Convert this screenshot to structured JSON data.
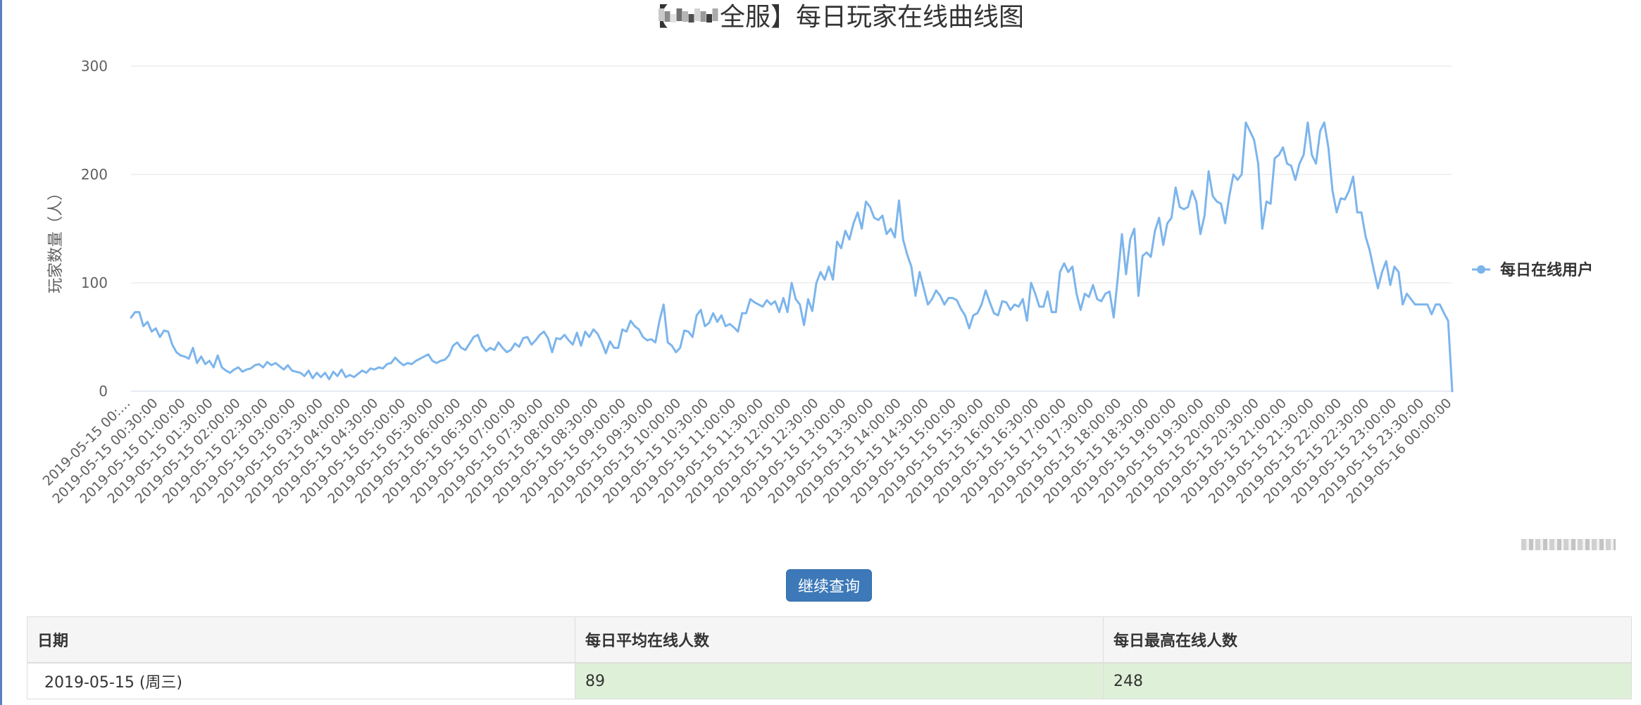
{
  "chart_data": {
    "type": "line",
    "title_prefix": "【",
    "title": "全服】每日玩家在线曲线图",
    "ylabel": "玩家数量（人）",
    "ylim": [
      0,
      300
    ],
    "yticks": [
      0,
      100,
      200,
      300
    ],
    "x_labels": [
      "2019-05-15 00:…",
      "2019-05-15 00:30:00",
      "2019-05-15 01:00:00",
      "2019-05-15 01:30:00",
      "2019-05-15 02:00:00",
      "2019-05-15 02:30:00",
      "2019-05-15 03:00:00",
      "2019-05-15 03:30:00",
      "2019-05-15 04:00:00",
      "2019-05-15 04:30:00",
      "2019-05-15 05:00:00",
      "2019-05-15 05:30:00",
      "2019-05-15 06:00:00",
      "2019-05-15 06:30:00",
      "2019-05-15 07:00:00",
      "2019-05-15 07:30:00",
      "2019-05-15 08:00:00",
      "2019-05-15 08:30:00",
      "2019-05-15 09:00:00",
      "2019-05-15 09:30:00",
      "2019-05-15 10:00:00",
      "2019-05-15 10:30:00",
      "2019-05-15 11:00:00",
      "2019-05-15 11:30:00",
      "2019-05-15 12:00:00",
      "2019-05-15 12:30:00",
      "2019-05-15 13:00:00",
      "2019-05-15 13:30:00",
      "2019-05-15 14:00:00",
      "2019-05-15 14:30:00",
      "2019-05-15 15:00:00",
      "2019-05-15 15:30:00",
      "2019-05-15 16:00:00",
      "2019-05-15 16:30:00",
      "2019-05-15 17:00:00",
      "2019-05-15 17:30:00",
      "2019-05-15 18:00:00",
      "2019-05-15 18:30:00",
      "2019-05-15 19:00:00",
      "2019-05-15 19:30:00",
      "2019-05-15 20:00:00",
      "2019-05-15 20:30:00",
      "2019-05-15 21:00:00",
      "2019-05-15 21:30:00",
      "2019-05-15 22:00:00",
      "2019-05-15 22:30:00",
      "2019-05-15 23:00:00",
      "2019-05-15 23:30:00",
      "2019-05-16 00:00:00"
    ],
    "series": [
      {
        "name": "每日在线用户",
        "color": "#7cb5ec",
        "values": [
          68,
          73,
          73,
          60,
          64,
          55,
          58,
          50,
          56,
          55,
          43,
          36,
          33,
          32,
          30,
          40,
          26,
          32,
          25,
          28,
          22,
          33,
          22,
          19,
          17,
          20,
          22,
          18,
          20,
          21,
          24,
          25,
          22,
          27,
          24,
          26,
          23,
          20,
          24,
          19,
          18,
          17,
          14,
          19,
          12,
          17,
          13,
          17,
          11,
          18,
          14,
          20,
          13,
          15,
          13,
          16,
          19,
          17,
          21,
          20,
          22,
          21,
          25,
          26,
          31,
          27,
          24,
          26,
          25,
          28,
          30,
          32,
          34,
          28,
          26,
          28,
          29,
          33,
          42,
          45,
          40,
          38,
          44,
          50,
          52,
          42,
          37,
          40,
          38,
          45,
          40,
          36,
          38,
          44,
          41,
          49,
          50,
          43,
          47,
          52,
          55,
          49,
          36,
          49,
          48,
          52,
          47,
          43,
          54,
          42,
          55,
          50,
          57,
          53,
          45,
          35,
          46,
          40,
          40,
          57,
          55,
          65,
          60,
          57,
          50,
          47,
          48,
          45,
          65,
          80,
          45,
          42,
          36,
          40,
          56,
          55,
          50,
          70,
          75,
          60,
          63,
          72,
          64,
          70,
          60,
          62,
          59,
          55,
          72,
          72,
          85,
          82,
          80,
          78,
          84,
          80,
          83,
          73,
          86,
          73,
          100,
          85,
          80,
          61,
          85,
          74,
          100,
          110,
          103,
          115,
          103,
          138,
          132,
          148,
          140,
          155,
          165,
          150,
          175,
          170,
          160,
          158,
          162,
          145,
          150,
          142,
          176,
          140,
          126,
          115,
          88,
          110,
          95,
          80,
          85,
          93,
          88,
          80,
          86,
          86,
          84,
          76,
          70,
          58,
          70,
          72,
          80,
          93,
          82,
          72,
          70,
          83,
          82,
          75,
          80,
          78,
          85,
          65,
          100,
          90,
          78,
          78,
          92,
          73,
          73,
          110,
          118,
          110,
          115,
          90,
          75,
          90,
          87,
          98,
          85,
          83,
          90,
          92,
          68,
          105,
          145,
          108,
          140,
          150,
          88,
          125,
          128,
          124,
          148,
          160,
          135,
          155,
          160,
          188,
          170,
          168,
          170,
          185,
          175,
          145,
          162,
          203,
          180,
          175,
          173,
          155,
          180,
          200,
          195,
          200,
          248,
          240,
          232,
          210,
          150,
          175,
          173,
          215,
          218,
          225,
          210,
          208,
          195,
          210,
          218,
          248,
          218,
          210,
          240,
          248,
          225,
          185,
          165,
          178,
          177,
          185,
          198,
          165,
          165,
          143,
          130,
          112,
          95,
          110,
          120,
          98,
          115,
          110,
          80,
          90,
          85,
          80,
          80,
          80,
          80,
          71,
          80,
          80,
          72,
          65,
          0
        ]
      }
    ],
    "legend_position": "right",
    "grid": true
  },
  "button": {
    "label": "继续查询"
  },
  "table": {
    "headers": [
      "日期",
      "每日平均在线人数",
      "每日最高在线人数"
    ],
    "rows": [
      [
        "2019-05-15 (周三)",
        "89",
        "248"
      ]
    ]
  }
}
